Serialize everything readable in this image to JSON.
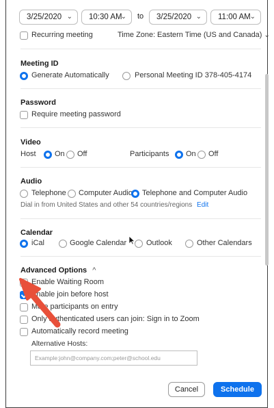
{
  "datetime": {
    "start_date": "3/25/2020",
    "start_time": "10:30 AM",
    "to_label": "to",
    "end_date": "3/25/2020",
    "end_time": "11:00 AM"
  },
  "recurring": {
    "label": "Recurring meeting",
    "checked": false
  },
  "timezone": {
    "label": "Time Zone:",
    "value": "Eastern Time (US and Canada)"
  },
  "meeting_id": {
    "title": "Meeting ID",
    "opt_auto": "Generate Automatically",
    "opt_personal": "Personal Meeting ID 378-405-4174",
    "selected": "auto"
  },
  "password": {
    "title": "Password",
    "require_label": "Require meeting password"
  },
  "video": {
    "title": "Video",
    "host_label": "Host",
    "participants_label": "Participants",
    "on": "On",
    "off": "Off"
  },
  "audio": {
    "title": "Audio",
    "opt_telephone": "Telephone",
    "opt_computer": "Computer Audio",
    "opt_both": "Telephone and Computer Audio",
    "dial_in": "Dial in from United States and other 54 countries/regions",
    "edit": "Edit"
  },
  "calendar": {
    "title": "Calendar",
    "opt_ical": "iCal",
    "opt_google": "Google Calendar",
    "opt_outlook": "Outlook",
    "opt_other": "Other Calendars"
  },
  "advanced": {
    "title": "Advanced Options",
    "chevron": "^",
    "waiting_room": "Enable Waiting Room",
    "join_before_host": "Enable join before host",
    "mute_on_entry": "Mute participants on entry",
    "auth_users": "Only authenticated users can join: Sign in to Zoom",
    "auto_record": "Automatically record meeting",
    "alt_hosts_label": "Alternative Hosts:",
    "alt_hosts_placeholder": "Example:john@company.com;peter@school.edu"
  },
  "buttons": {
    "cancel": "Cancel",
    "schedule": "Schedule"
  },
  "colors": {
    "accent": "#0e72ed",
    "annotation_arrow": "#e8503a"
  }
}
